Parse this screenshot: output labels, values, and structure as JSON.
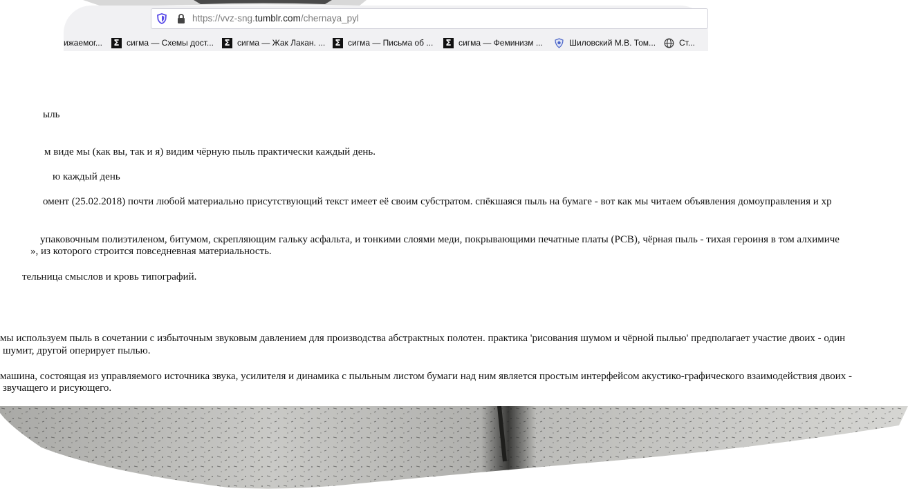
{
  "browser": {
    "url_prefix": "https://vvz-sng.",
    "url_host": "tumblr.com",
    "url_path": "/chernaya_pyl",
    "bookmarks": [
      {
        "icon": "partial",
        "label": "ижаемог..."
      },
      {
        "icon": "sigma-icon",
        "label": "сигма — Схемы дост..."
      },
      {
        "icon": "sigma-icon",
        "label": "сигма — Жак Лакан. ..."
      },
      {
        "icon": "sigma-icon",
        "label": "сигма — Письма об ..."
      },
      {
        "icon": "sigma-icon",
        "label": "сигма — Феминизм ..."
      },
      {
        "icon": "shield-icon",
        "label": "Шиловский М.В. Том..."
      },
      {
        "icon": "globe-icon",
        "label": "Ст..."
      }
    ]
  },
  "content": {
    "lines": [
      "ыль",
      "м виде мы (как вы, так и я) видим чёрную пыль практически каждый день.",
      "ю каждый день",
      "омент (25.02.2018) почти любой материально присутствующий текст имеет её своим субстратом. спёкшаяся пыль на бумаге - вот как мы читаем объявления домоуправления и хр",
      "упаковочным полиэтиленом, битумом, скрепляющим гальку асфальта, и тонкими слоями меди, покрывающими печатные платы (PCB), чёрная пыль - тихая героиня в том алхимиче",
      "», из которого строится повседневная материальность.",
      "тельница смыслов и кровь типографий.",
      "мы используем пыль в сочетании с избыточным звуковым давлением для производства абстрактных полотен. практика 'рисования шумом и чёрной пылью' предполагает участие двоих - один",
      "шумит, другой оперирует пылью.",
      "машина, состоящая из управляемого источника звука, усилителя и динамика с пыльным листом бумаги над ним является простым интерфейсом акустико-графического взаимодействия двоих -",
      "звучащего и рисующего."
    ]
  }
}
